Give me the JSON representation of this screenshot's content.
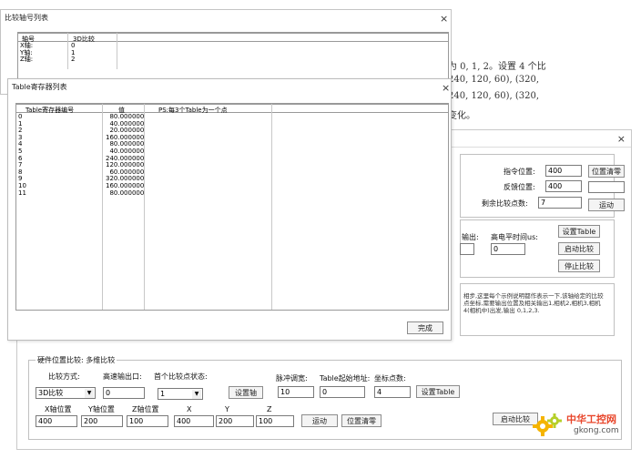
{
  "doc_text": {
    "line1": "为 0, 1, 2。设置 4 个比",
    "line2": "240, 120, 60), (320,",
    "line3": "240, 120, 60), (320,",
    "line4": "变化。"
  },
  "axis_window": {
    "title": "比较轴号列表",
    "headers": [
      "轴号",
      "3D比较"
    ],
    "rows": [
      [
        "X轴:",
        "0"
      ],
      [
        "Y轴:",
        "1"
      ],
      [
        "Z轴:",
        "2"
      ]
    ]
  },
  "table_window": {
    "title": "Table寄存器列表",
    "headers": [
      "Table寄存器编号",
      "值",
      "PS:每3个Table为一个点"
    ],
    "rows": [
      [
        "0",
        "80.000000"
      ],
      [
        "1",
        "40.000000"
      ],
      [
        "2",
        "20.000000"
      ],
      [
        "3",
        "160.000000"
      ],
      [
        "4",
        "80.000000"
      ],
      [
        "5",
        "40.000000"
      ],
      [
        "6",
        "240.000000"
      ],
      [
        "7",
        "120.000000"
      ],
      [
        "8",
        "60.000000"
      ],
      [
        "9",
        "320.000000"
      ],
      [
        "10",
        "160.000000"
      ],
      [
        "11",
        "80.000000"
      ]
    ],
    "done_label": "完成"
  },
  "main_dialog": {
    "cmd_pos_label": "指令位置:",
    "cmd_pos_value": "400",
    "feedback_pos_label": "反馈位置:",
    "feedback_pos_value": "400",
    "remaining_label": "剩余比较点数:",
    "remaining_value": "7",
    "pos_clear_label": "位置清零",
    "move_label": "运动",
    "output_label": "输出:",
    "output_time_label": "高电平时间us:",
    "output_time_value": "0",
    "set_table_label": "设置Table",
    "start_compare_label": "启动比较",
    "stop_compare_label": "停止比较",
    "note": "相步,这里每个示例说明都作表示一下,该轴给定的比较点坐标,需要输出位置及相关输出1,相机2,相机3,相机4(相机中)出发,输出 0,1,2,3."
  },
  "bottom_group": {
    "title": "硬件位置比较: 多维比较",
    "mode_label": "比较方式:",
    "mode_value": "3D比较",
    "output_port_label": "高速输出口:",
    "output_port_value": "0",
    "first_state_label": "首个比较点状态:",
    "first_state_value": "1",
    "set_axis_label": "设置轴",
    "pulse_width_label": "脉冲调宽:",
    "pulse_width_value": "10",
    "table_start_label": "Table起始地址:",
    "table_start_value": "0",
    "coord_count_label": "坐标点数:",
    "coord_count_value": "4",
    "set_table_label": "设置Table",
    "x_pos_label": "X轴位置",
    "x_pos_value": "400",
    "y_pos_label": "Y轴位置",
    "y_pos_value": "200",
    "z_pos_label": "Z轴位置",
    "z_pos_value": "100",
    "x_label": "X",
    "x_value": "400",
    "y_label": "Y",
    "y_value": "200",
    "z_label": "Z",
    "z_value": "100",
    "move_label": "运动",
    "pos_clear_label": "位置清零"
  },
  "watermark": {
    "line1": "中华工控网",
    "line2": "gkong.com"
  }
}
